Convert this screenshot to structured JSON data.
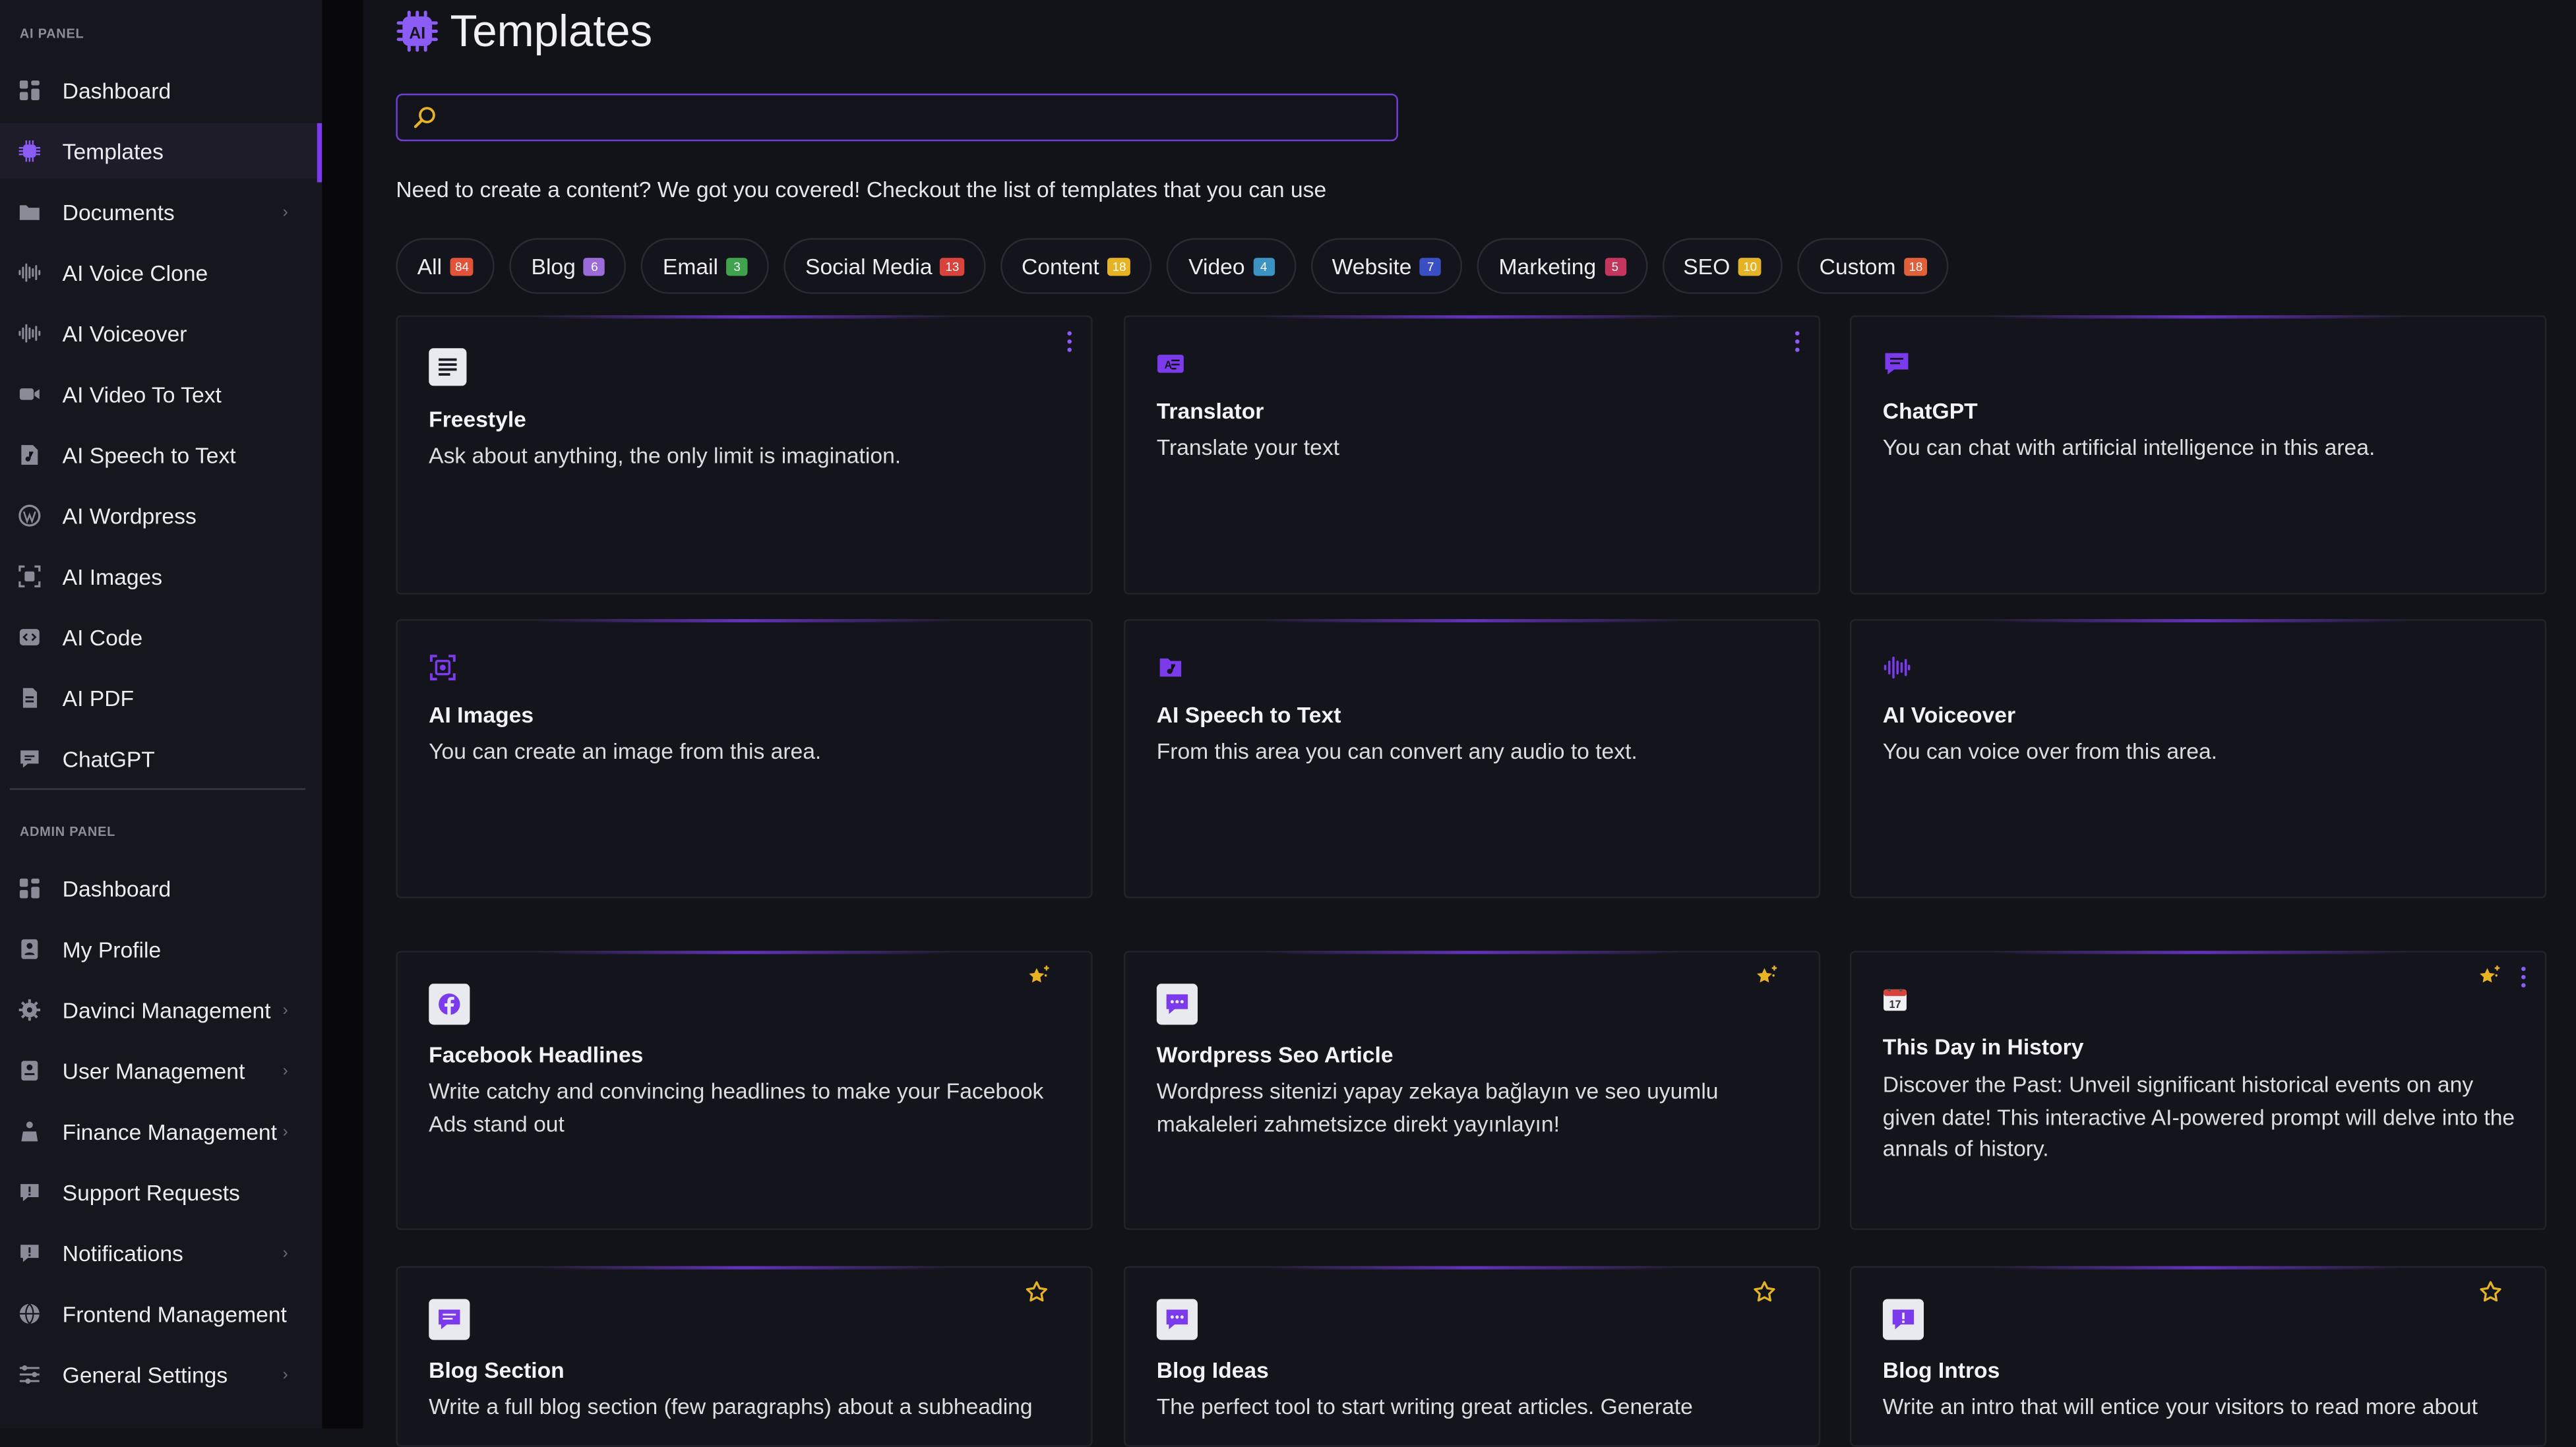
{
  "sidebar": {
    "ai_section_title": "AI PANEL",
    "admin_section_title": "ADMIN PANEL",
    "ai_items": [
      {
        "label": "Dashboard",
        "icon": "dashboard-icon"
      },
      {
        "label": "Templates",
        "icon": "ai-chip-icon",
        "active": true
      },
      {
        "label": "Documents",
        "icon": "folder-icon",
        "has_children": true
      },
      {
        "label": "AI Voice Clone",
        "icon": "waveform-icon"
      },
      {
        "label": "AI Voiceover",
        "icon": "waveform-icon"
      },
      {
        "label": "AI Video To Text",
        "icon": "video-camera-icon"
      },
      {
        "label": "AI Speech to Text",
        "icon": "audio-file-icon"
      },
      {
        "label": "AI Wordpress",
        "icon": "wordpress-icon"
      },
      {
        "label": "AI Images",
        "icon": "image-scan-icon"
      },
      {
        "label": "AI Code",
        "icon": "code-icon"
      },
      {
        "label": "AI PDF",
        "icon": "pdf-icon"
      },
      {
        "label": "ChatGPT",
        "icon": "chat-icon"
      }
    ],
    "admin_items": [
      {
        "label": "Dashboard",
        "icon": "dashboard-icon"
      },
      {
        "label": "My Profile",
        "icon": "profile-icon"
      },
      {
        "label": "Davinci Management",
        "icon": "gear-icon",
        "has_children": true
      },
      {
        "label": "User Management",
        "icon": "users-icon",
        "has_children": true
      },
      {
        "label": "Finance Management",
        "icon": "finance-icon",
        "has_children": true
      },
      {
        "label": "Support Requests",
        "icon": "support-icon"
      },
      {
        "label": "Notifications",
        "icon": "notification-icon",
        "has_children": true
      },
      {
        "label": "Frontend Management",
        "icon": "globe-icon"
      },
      {
        "label": "General Settings",
        "icon": "sliders-icon",
        "has_children": true
      }
    ]
  },
  "header": {
    "title": "Templates"
  },
  "search": {
    "value": "",
    "placeholder": ""
  },
  "intro_text": "Need to create a content? We got you covered! Checkout the list of templates that you can use",
  "filters": [
    {
      "label": "All",
      "count": "84",
      "color": "#e2533a"
    },
    {
      "label": "Blog",
      "count": "6",
      "color": "#9b6bd9"
    },
    {
      "label": "Email",
      "count": "3",
      "color": "#3fa34d"
    },
    {
      "label": "Social Media",
      "count": "13",
      "color": "#d9433b"
    },
    {
      "label": "Content",
      "count": "18",
      "color": "#e6b325"
    },
    {
      "label": "Video",
      "count": "4",
      "color": "#3b93c4"
    },
    {
      "label": "Website",
      "count": "7",
      "color": "#3b4fc4"
    },
    {
      "label": "Marketing",
      "count": "5",
      "color": "#c4365b"
    },
    {
      "label": "SEO",
      "count": "10",
      "color": "#e6b325"
    },
    {
      "label": "Custom",
      "count": "18",
      "color": "#e0603a"
    }
  ],
  "cards": [
    {
      "title": "Freestyle",
      "description": "Ask about anything, the only limit is imagination.",
      "icon": "text-lines-icon",
      "favorite": null,
      "menu": true
    },
    {
      "title": "Translator",
      "description": "Translate your text",
      "icon": "translate-icon",
      "favorite": null,
      "menu": true
    },
    {
      "title": "ChatGPT",
      "description": "You can chat with artificial intelligence in this area.",
      "icon": "chat-icon",
      "favorite": null,
      "menu": false
    },
    {
      "title": "AI Images",
      "description": "You can create an image from this area.",
      "icon": "image-scan-icon",
      "favorite": null,
      "menu": false
    },
    {
      "title": "AI Speech to Text",
      "description": "From this area you can convert any audio to text.",
      "icon": "audio-file-icon",
      "favorite": null,
      "menu": false
    },
    {
      "title": "AI Voiceover",
      "description": "You can voice over from this area.",
      "icon": "waveform-icon",
      "favorite": null,
      "menu": false
    },
    {
      "title": "Facebook Headlines",
      "description": "Write catchy and convincing headlines to make your Facebook Ads stand out",
      "icon": "facebook-icon",
      "favorite": true,
      "menu": false
    },
    {
      "title": "Wordpress Seo Article",
      "description": "Wordpress sitenizi yapay zekaya bağlayın ve seo uyumlu makaleleri zahmetsizce direkt yayınlayın!",
      "icon": "chat-bubble-icon",
      "favorite": true,
      "menu": false
    },
    {
      "title": "This Day in History",
      "description": "Discover the Past: Unveil significant historical events on any given date! This interactive AI-powered prompt will delve into the annals of history.",
      "icon": "calendar-icon",
      "favorite": true,
      "menu": true
    },
    {
      "title": "Blog Section",
      "description": "Write a full blog section (few paragraphs) about a subheading",
      "icon": "message-icon",
      "favorite": false,
      "menu": false
    },
    {
      "title": "Blog Ideas",
      "description": "The perfect tool to start writing great articles. Generate",
      "icon": "chat-bubble-icon",
      "favorite": false,
      "menu": false
    },
    {
      "title": "Blog Intros",
      "description": "Write an intro that will entice your visitors to read more about",
      "icon": "alert-message-icon",
      "favorite": false,
      "menu": false
    }
  ]
}
